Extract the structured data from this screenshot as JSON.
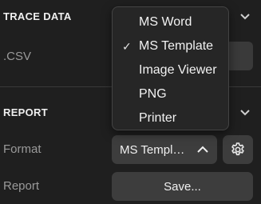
{
  "trace_section": {
    "title": "TRACE DATA",
    "csv_label": ".CSV"
  },
  "report_section": {
    "title": "REPORT",
    "format_label": "Format",
    "report_label": "Report",
    "format_value": "MS Templ…",
    "save_label": "Save..."
  },
  "format_menu": {
    "selected": "MS Template",
    "options": [
      "MS Word",
      "MS Template",
      "Image Viewer",
      "PNG",
      "Printer"
    ]
  },
  "icons": {
    "trace_chevron": "chevron-down-icon",
    "report_chevron": "chevron-down-icon",
    "select_chevron": "chevron-up-icon",
    "settings": "gear-icon",
    "checkmark": "checkmark-icon"
  }
}
